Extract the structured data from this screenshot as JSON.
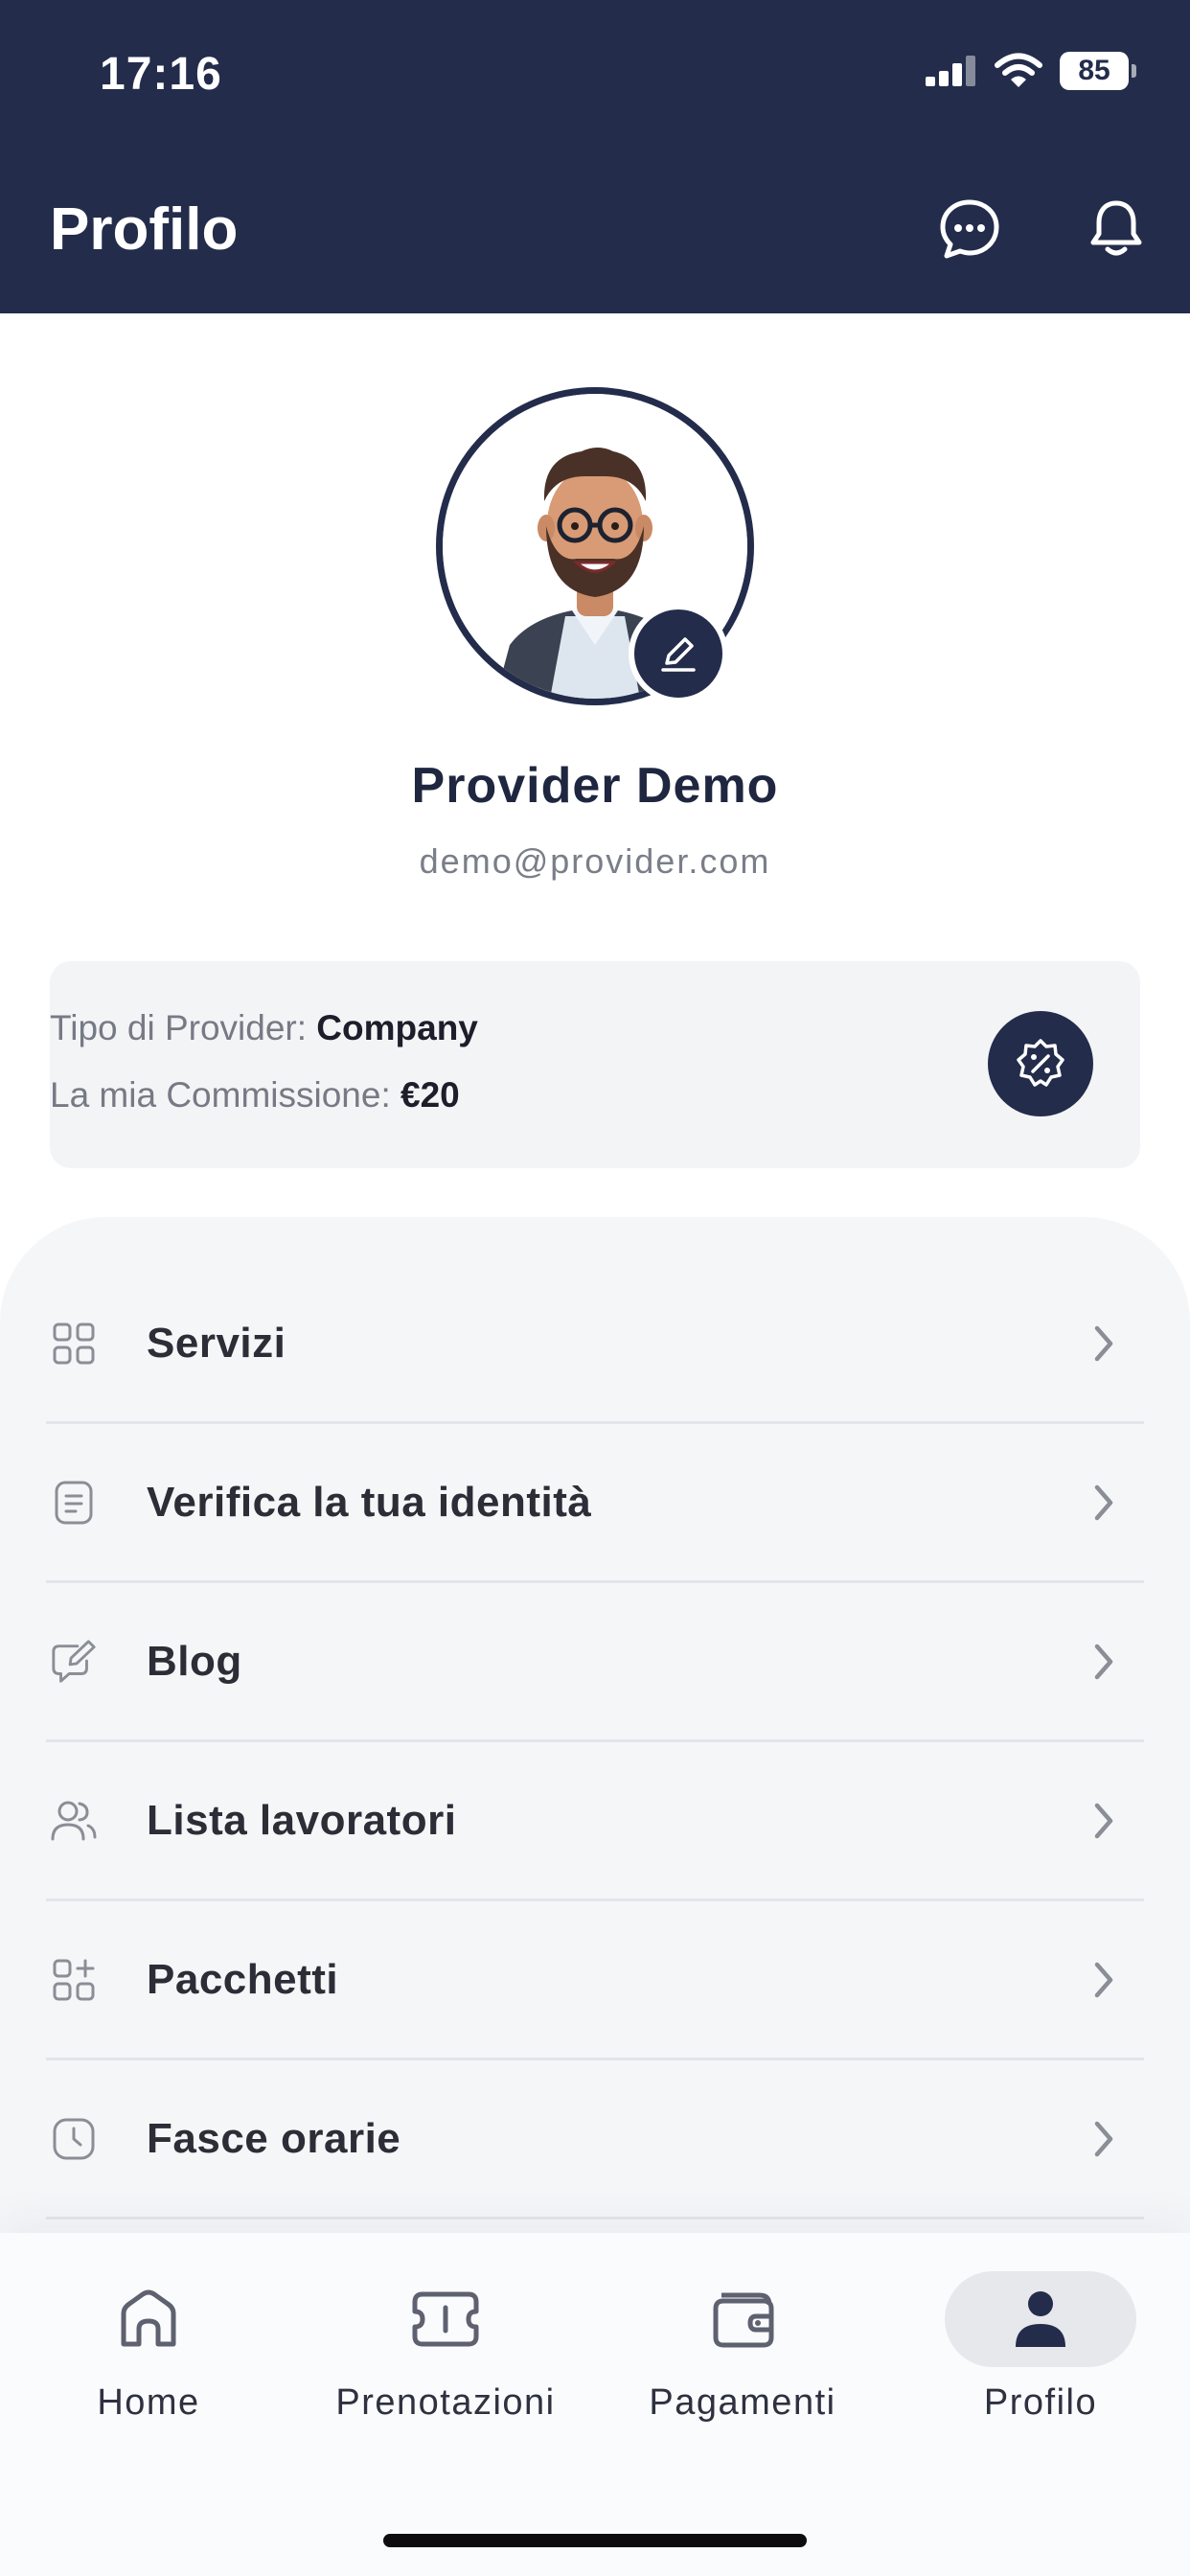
{
  "status_bar": {
    "time": "17:16",
    "battery": "85"
  },
  "header": {
    "title": "Profilo"
  },
  "profile": {
    "name": "Provider Demo",
    "email": "demo@provider.com"
  },
  "info_card": {
    "provider_type_label": "Tipo di Provider:",
    "provider_type_value": "Company",
    "commission_label": "La mia Commissione:",
    "commission_value": "€20"
  },
  "menu": {
    "items": [
      {
        "label": "Servizi",
        "icon": "grid-icon"
      },
      {
        "label": "Verifica la tua identità",
        "icon": "document-icon"
      },
      {
        "label": "Blog",
        "icon": "edit-message-icon"
      },
      {
        "label": "Lista lavoratori",
        "icon": "users-icon"
      },
      {
        "label": "Pacchetti",
        "icon": "add-grid-icon"
      },
      {
        "label": "Fasce orarie",
        "icon": "clock-icon"
      }
    ]
  },
  "tabs": [
    {
      "label": "Home",
      "icon": "home-icon"
    },
    {
      "label": "Prenotazioni",
      "icon": "ticket-icon"
    },
    {
      "label": "Pagamenti",
      "icon": "wallet-icon"
    },
    {
      "label": "Profilo",
      "icon": "user-icon",
      "active": true
    }
  ],
  "colors": {
    "primary": "#232c4b",
    "panel": "#f5f6f8",
    "card": "#f3f4f6"
  }
}
